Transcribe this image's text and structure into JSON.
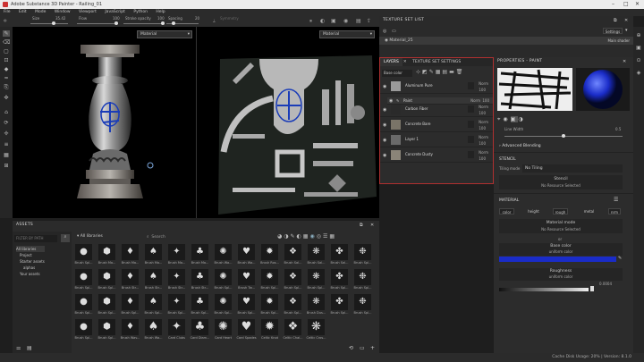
{
  "window": {
    "title": "Adobe Substance 3D Painter - Railing_01"
  },
  "menu": [
    "File",
    "Edit",
    "Mode",
    "Window",
    "Viewport",
    "JavaScript",
    "Python",
    "Help"
  ],
  "toolbar": {
    "size_label": "Size",
    "size_value": "35.42",
    "flow_label": "Flow",
    "flow_value": "100",
    "stroke_label": "Stroke opacity",
    "stroke_value": "100",
    "spacing_label": "Spacing",
    "spacing_value": "20",
    "symmetry_label": "Symmetry"
  },
  "viewports": {
    "left_mode": "Material",
    "right_mode": "Material"
  },
  "texture_set_list": {
    "title": "TEXTURE SET LIST",
    "settings": "Settings",
    "item": "Material_25",
    "shader": "Main shader"
  },
  "layers": {
    "tabs": [
      "LAYERS",
      "TEXTURE SET SETTINGS"
    ],
    "channel": "Base color",
    "rows": [
      {
        "name": "Aluminum Pure",
        "blend": "Norm",
        "opacity": "100"
      },
      {
        "name": "Paint",
        "blend": "Norm",
        "opacity": "100"
      },
      {
        "name": "Carbon Fiber",
        "blend": "Norm",
        "opacity": "100"
      },
      {
        "name": "Concrete Bare",
        "blend": "Norm",
        "opacity": "100"
      },
      {
        "name": "Layer 1",
        "blend": "Norm",
        "opacity": "100"
      },
      {
        "name": "Concrete Dusty",
        "blend": "Norm",
        "opacity": "100"
      }
    ]
  },
  "properties": {
    "title": "PROPERTIES - PAINT",
    "line_width_label": "Line Width",
    "line_width_value": "0.5",
    "advanced_blending": "Advanced Blending",
    "stencil_header": "STENCIL",
    "tiling_label": "Tiling mode",
    "tiling_value": "No Tiling",
    "stencil_label": "Stencil",
    "stencil_value": "No Resource Selected",
    "material_header": "MATERIAL",
    "channels": [
      "color",
      "height",
      "rough",
      "metal",
      "nrm"
    ],
    "material_mode_label": "Material mode",
    "material_mode_value": "No Resource Selected",
    "or": "or",
    "base_color_label": "Base color",
    "base_color_sub": "uniform color",
    "base_color_hex": "#1a2cc8",
    "roughness_label": "Roughness",
    "roughness_sub": "uniform color",
    "roughness_value": "0.0004"
  },
  "assets": {
    "title": "ASSETS",
    "filter_placeholder": "FILTER BY PATH",
    "path": "All libraries",
    "search_placeholder": "Search",
    "tree": [
      "All libraries",
      "Project",
      "Starter assets",
      "alphas",
      "Your assets"
    ],
    "items": [
      "Brush Spl...",
      "Brush Ma...",
      "Brush Ma...",
      "Brush Ma...",
      "Brush Ma...",
      "Brush Ma...",
      "Brush Wa...",
      "Brush Wa...",
      "Brush Ros...",
      "Brush Sal...",
      "Brush Sal...",
      "Brush Sal...",
      "Brush Spl...",
      "Brush Spl...",
      "Brush Spl...",
      "Brush Str...",
      "Brush Str...",
      "Brush Str...",
      "Brush Str...",
      "Brush Spl...",
      "Brush Tw...",
      "Brush Spl...",
      "Brush Spl...",
      "Brush Spl...",
      "Brush Spl...",
      "Brush Spl...",
      "Brush Spl...",
      "Brush Spl...",
      "Brush Spl...",
      "Brush Spl...",
      "Brush Spl...",
      "Brush Spl...",
      "Brush Spl...",
      "Brush Spl...",
      "Brush Spl...",
      "Brush Spl...",
      "Brush Dus...",
      "Brush Spl...",
      "Brush Spl...",
      "Brush Spl...",
      "Brush Spl...",
      "Brush Wav...",
      "Brush Wa...",
      "Card Clubs",
      "Card Diam...",
      "Card Heart",
      "Card Spades",
      "Celtic Knot",
      "Celtic Chai...",
      "Celtic Cros..."
    ]
  },
  "status": {
    "text": "Cache Disk Usage:  20% | Version: 8.1.0"
  }
}
